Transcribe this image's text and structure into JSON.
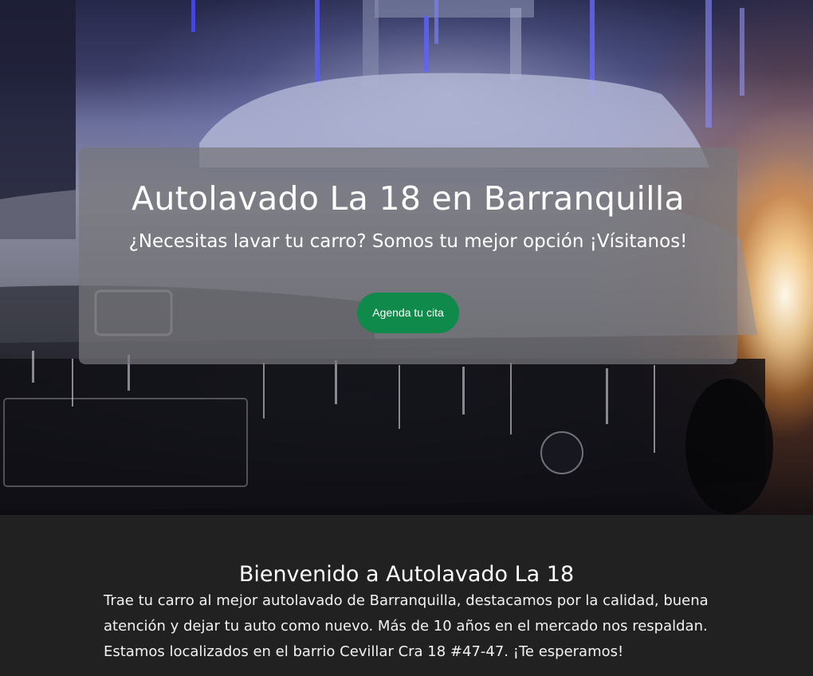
{
  "hero": {
    "title": "Autolavado La 18 en Barranquilla",
    "subtitle": "¿Necesitas lavar tu carro? Somos tu mejor opción ¡Vísitanos!",
    "cta_label": "Agenda tu cita",
    "background_image": "car covered in foam inside a car wash",
    "colors": {
      "cta": "#0f8a4a",
      "card_overlay": "#76767a"
    }
  },
  "welcome": {
    "title": "Bienvenido a Autolavado La 18",
    "text": "Trae tu carro al mejor autolavado de Barranquilla, destacamos por la calidad, buena atención y dejar tu auto como nuevo. Más de 10 años en el mercado nos respaldan. Estamos localizados en el barrio Cevillar Cra 18 #47-47. ¡Te esperamos!",
    "colors": {
      "background": "#212121",
      "text": "#ffffff"
    }
  }
}
